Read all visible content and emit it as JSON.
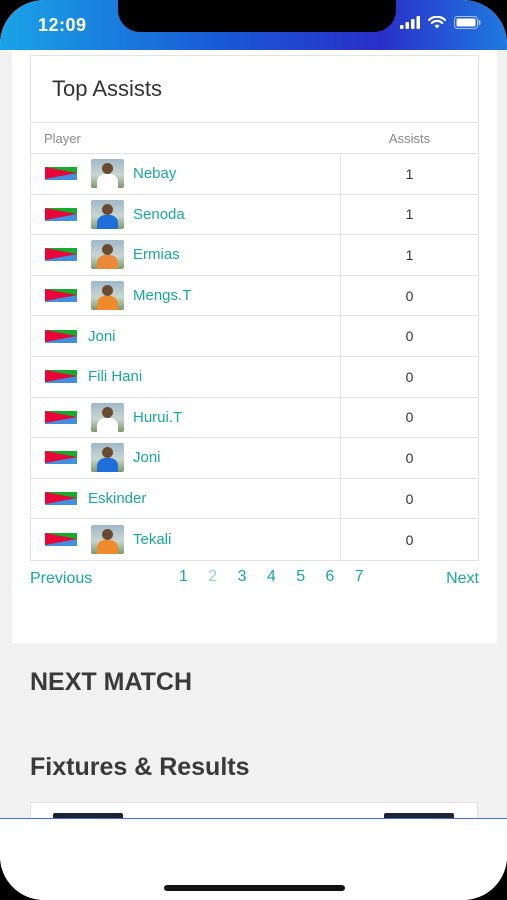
{
  "status_bar": {
    "time": "12:09"
  },
  "assists_card": {
    "title": "Top Assists",
    "columns": {
      "player": "Player",
      "assists": "Assists"
    },
    "rows": [
      {
        "name": "Nebay",
        "assists": "1",
        "has_photo": true,
        "kit_color": "#ffffff"
      },
      {
        "name": "Senoda",
        "assists": "1",
        "has_photo": true,
        "kit_color": "#1e6fd9"
      },
      {
        "name": "Ermias",
        "assists": "1",
        "has_photo": true,
        "kit_color": "#e88a3a"
      },
      {
        "name": "Mengs.T",
        "assists": "0",
        "has_photo": true,
        "kit_color": "#f08b2c"
      },
      {
        "name": "Joni",
        "assists": "0",
        "has_photo": false
      },
      {
        "name": "Fili Hani",
        "assists": "0",
        "has_photo": false
      },
      {
        "name": "Hurui.T",
        "assists": "0",
        "has_photo": true,
        "kit_color": "#ffffff"
      },
      {
        "name": "Joni",
        "assists": "0",
        "has_photo": true,
        "kit_color": "#1e6fd9"
      },
      {
        "name": "Eskinder",
        "assists": "0",
        "has_photo": false
      },
      {
        "name": "Tekali",
        "assists": "0",
        "has_photo": true,
        "kit_color": "#f08b2c"
      }
    ]
  },
  "pagination": {
    "previous": "Previous",
    "next": "Next",
    "pages": [
      "1",
      "2",
      "3",
      "4",
      "5",
      "6",
      "7"
    ],
    "current": "2"
  },
  "sections": {
    "next_match": "NEXT MATCH",
    "fixtures": "Fixtures & Results"
  },
  "colors": {
    "accent": "#19a89b",
    "status_gradient_start": "#1aa3e6",
    "status_gradient_end": "#2a2fc9"
  }
}
